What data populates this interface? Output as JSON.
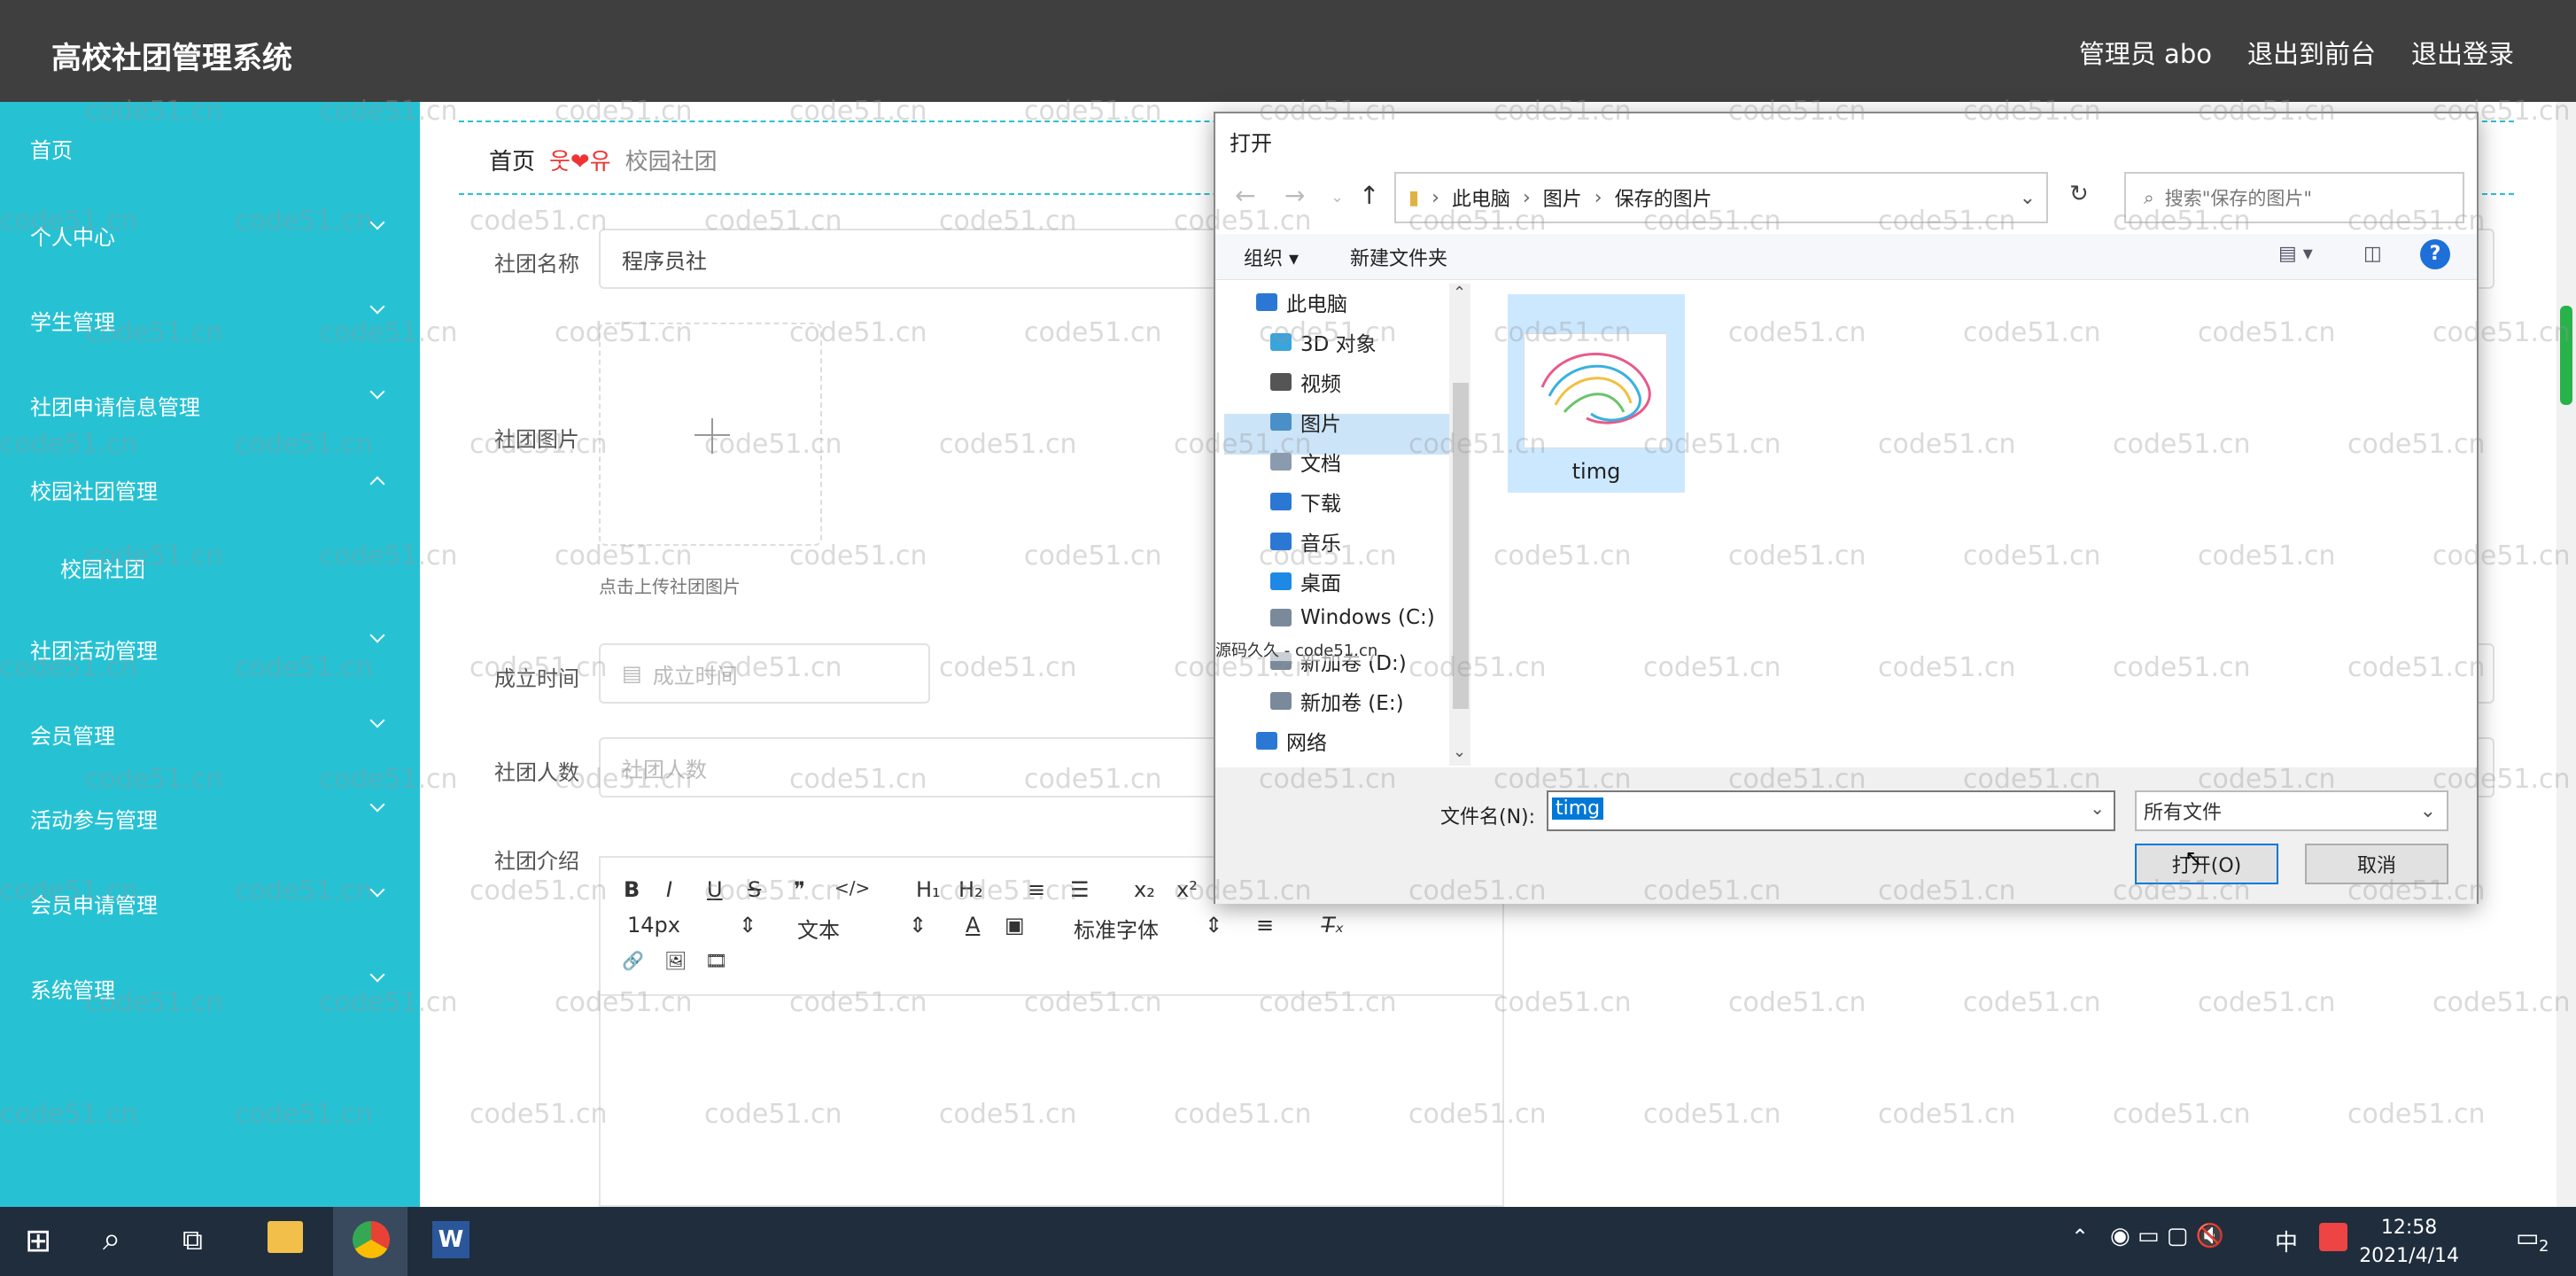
{
  "header": {
    "brand": "高校社团管理系统",
    "nav": [
      "管理员 abo",
      "退出到前台",
      "退出登录"
    ]
  },
  "sidebar": {
    "items": [
      {
        "label": "首页",
        "chevron": ""
      },
      {
        "label": "个人中心",
        "chevron": "down"
      },
      {
        "label": "学生管理",
        "chevron": "down"
      },
      {
        "label": "社团申请信息管理",
        "chevron": "down"
      },
      {
        "label": "校园社团管理",
        "chevron": "up"
      },
      {
        "label": "校园社团",
        "chevron": ""
      },
      {
        "label": "社团活动管理",
        "chevron": "down"
      },
      {
        "label": "会员管理",
        "chevron": "down"
      },
      {
        "label": "活动参与管理",
        "chevron": "down"
      },
      {
        "label": "会员申请管理",
        "chevron": "down"
      },
      {
        "label": "系统管理",
        "chevron": "down"
      }
    ]
  },
  "breadcrumb": {
    "home": "首页",
    "deco": "웃❤유",
    "current": "校园社团"
  },
  "form": {
    "name_label": "社团名称",
    "name_value": "程序员社",
    "image_label": "社团图片",
    "upload_hint": "点击上传社团图片",
    "date_label": "成立时间",
    "date_placeholder": "成立时间",
    "count_label": "社团人数",
    "count_placeholder": "社团人数",
    "intro_label": "社团介绍"
  },
  "editor": {
    "row1": [
      "B",
      "I",
      "U",
      "S",
      "❞",
      "</>",
      "H₁",
      "H₂",
      "≡",
      "☰",
      "x₂",
      "x²"
    ],
    "font_size": "14px",
    "text_style": "文本",
    "font_family": "标准字体",
    "row3": [
      "🔗",
      "🖼",
      "🎞"
    ]
  },
  "dialog": {
    "title": "打开",
    "path": [
      "此电脑",
      "图片",
      "保存的图片"
    ],
    "search_placeholder": "搜索\"保存的图片\"",
    "organize": "组织 ▾",
    "new_folder": "新建文件夹",
    "tree": [
      {
        "label": "此电脑",
        "icon": "computer-icon",
        "color": "#2b78d4"
      },
      {
        "label": "3D 对象",
        "icon": "cube-icon",
        "color": "#3aa4dc"
      },
      {
        "label": "视频",
        "icon": "film-icon",
        "color": "#555555"
      },
      {
        "label": "图片",
        "icon": "picture-icon",
        "color": "#4a90c8"
      },
      {
        "label": "文档",
        "icon": "document-icon",
        "color": "#8a9bb0"
      },
      {
        "label": "下载",
        "icon": "download-icon",
        "color": "#2b78d4"
      },
      {
        "label": "音乐",
        "icon": "music-icon",
        "color": "#2b78d4"
      },
      {
        "label": "桌面",
        "icon": "desktop-icon",
        "color": "#1e88e5"
      },
      {
        "label": "Windows (C:)",
        "icon": "drive-icon",
        "color": "#7a8a9a"
      },
      {
        "label": "新加卷 (D:)",
        "icon": "drive-icon",
        "color": "#7a8a9a"
      },
      {
        "label": "新加卷 (E:)",
        "icon": "drive-icon",
        "color": "#7a8a9a"
      },
      {
        "label": "网络",
        "icon": "network-icon",
        "color": "#2b78d4"
      }
    ],
    "overlay_text": "源码久久 - code51.cn",
    "file": "timg",
    "filename_label": "文件名(N):",
    "filename_value": "timg",
    "filetype": "所有文件",
    "open_button": "打开(O)",
    "cancel_button": "取消"
  },
  "taskbar": {
    "time": "12:58",
    "date": "2021/4/14",
    "ime": "中",
    "notifications": "2"
  },
  "watermark": "code51.cn"
}
